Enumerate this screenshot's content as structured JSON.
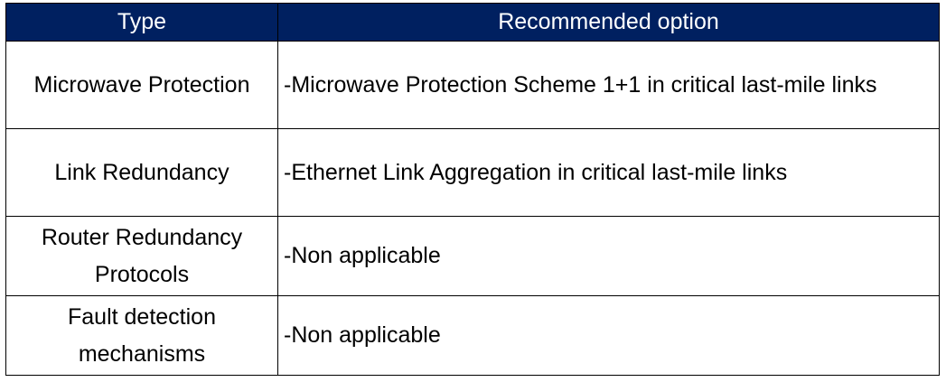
{
  "table": {
    "headers": {
      "type": "Type",
      "option": "Recommended option"
    },
    "rows": [
      {
        "type": "Microwave Protection",
        "option": "-Microwave Protection Scheme 1+1 in critical last-mile links"
      },
      {
        "type": "Link Redundancy",
        "option": "-Ethernet Link Aggregation in critical last-mile links"
      },
      {
        "type": "Router Redundancy Protocols",
        "option": "-Non applicable"
      },
      {
        "type": "Fault detection mechanisms",
        "option": "-Non applicable"
      }
    ],
    "colors": {
      "header_background": "#002060",
      "header_text": "#ffffff",
      "border": "#000000"
    }
  }
}
